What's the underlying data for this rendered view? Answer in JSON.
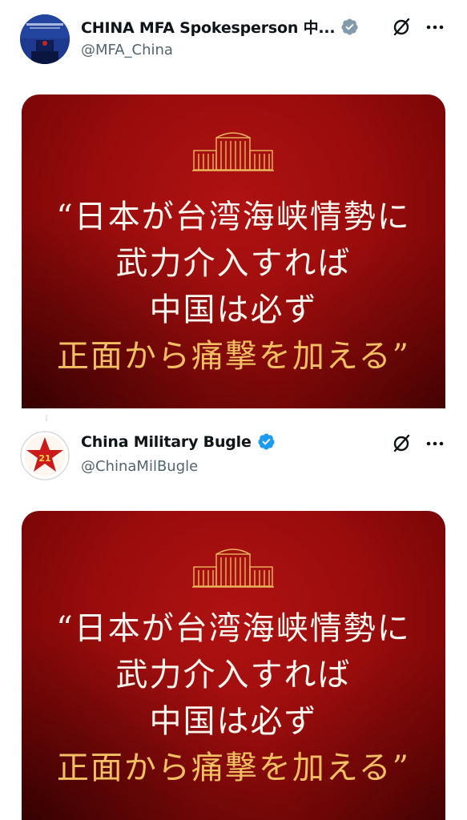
{
  "posts": [
    {
      "display_name": "CHINA MFA Spokesperson 中...",
      "handle": "@MFA_China",
      "verified": "gray-verified-badge",
      "quote": {
        "line1": "“日本が台湾海峡情勢に",
        "line2": "武力介入すれば",
        "line3": "中国は必ず",
        "line4": "正面から痛撃を加える”"
      }
    },
    {
      "display_name": "China Military Bugle",
      "handle": "@ChinaMilBugle",
      "verified": "blue-verified-badge",
      "avatar_text": "21",
      "quote": {
        "line1": "“日本が台湾海峡情勢に",
        "line2": "武力介入すれば",
        "line3": "中国は必ず",
        "line4": "正面から痛撃を加える”"
      }
    }
  ],
  "colors": {
    "card_red": "#9a0c0c",
    "quote_white": "#fbf6ee",
    "quote_gold": "#f2c063",
    "blue_badge": "#1d9bf0",
    "gray_badge": "#829aab",
    "handle_gray": "#536471"
  },
  "icons": {
    "grok": "grok-slash-icon",
    "more": "more-dots-icon"
  }
}
